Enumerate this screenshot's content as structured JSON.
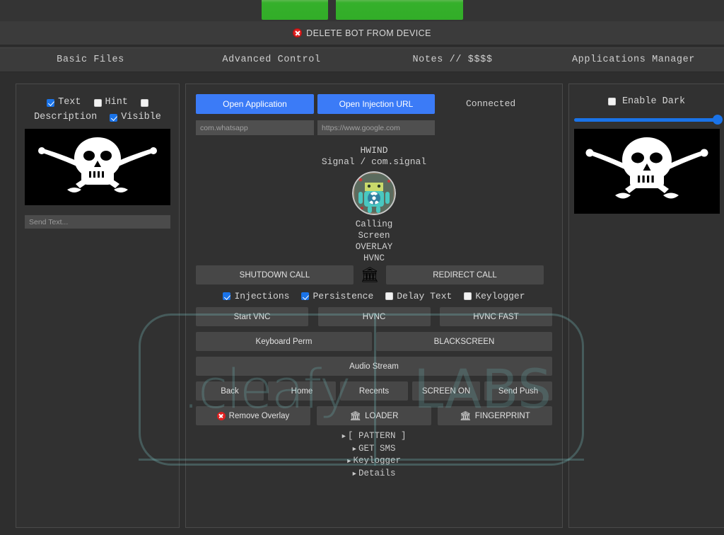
{
  "topbar": {
    "green_buttons": [
      {
        "label": ""
      },
      {
        "label": ""
      }
    ],
    "green_color": "#33b02a",
    "delete_label": "DELETE BOT FROM DEVICE",
    "delete_icon": "close-circle-icon"
  },
  "tabs": [
    {
      "label": "Basic Files"
    },
    {
      "label": "Advanced Control"
    },
    {
      "label": "Notes // $$$$"
    },
    {
      "label": "Applications Manager"
    }
  ],
  "left_panel": {
    "checkbox_row1": [
      {
        "label": "Text",
        "checked": true
      },
      {
        "label": "Hint",
        "checked": false
      },
      {
        "label": "",
        "checked": false
      }
    ],
    "checkbox_row2": [
      {
        "label": "Description",
        "checked": false,
        "standalone_label": true
      },
      {
        "label": "Visible",
        "checked": true
      }
    ],
    "image_alt": "pirate-skull-flag",
    "send_text_placeholder": "Send Text..."
  },
  "center_panel": {
    "open_application_label": "Open Application",
    "open_injection_label": "Open Injection URL",
    "status": "Connected",
    "package_input_placeholder": "com.whatsapp",
    "url_input_placeholder": "https://www.google.com",
    "device_tag": "HWIND",
    "app_line": "Signal / com.signal",
    "avatar_icon": "android-biohazard-icon",
    "stack": [
      "Calling",
      "Screen",
      "OVERLAY",
      "HVNC"
    ],
    "shutdown_call_label": "SHUTDOWN CALL",
    "bank_icon": "bank-icon",
    "redirect_call_label": "REDIRECT CALL",
    "options": [
      {
        "label": "Injections",
        "checked": true
      },
      {
        "label": "Persistence",
        "checked": true
      },
      {
        "label": "Delay Text",
        "checked": false
      },
      {
        "label": "Keylogger",
        "checked": false
      }
    ],
    "vnc_row": [
      "Start VNC",
      "HVNC",
      "HVNC FAST"
    ],
    "kb_row": [
      "Keyboard Perm",
      "BLACKSCREEN"
    ],
    "audio_label": "Audio Stream",
    "nav_row": [
      "Back",
      "Home",
      "Recents",
      "SCREEN ON",
      "Send Push"
    ],
    "loader_row": [
      {
        "label": "Remove Overlay",
        "icon": "close-circle-icon"
      },
      {
        "label": "LOADER",
        "icon": "bank-icon"
      },
      {
        "label": "FINGERPRINT",
        "icon": "bank-icon"
      }
    ],
    "tree": [
      "[ PATTERN ]",
      "GET SMS",
      "Keylogger",
      "Details"
    ]
  },
  "right_panel": {
    "enable_dark_label": "Enable Dark",
    "enable_dark_checked": false,
    "slider_value": 100,
    "slider_color": "#1a73e8",
    "image_alt": "pirate-skull-flag"
  },
  "watermark": {
    "brand": ".cleafy",
    "suffix": "LABS",
    "color": "#69aaaa"
  }
}
